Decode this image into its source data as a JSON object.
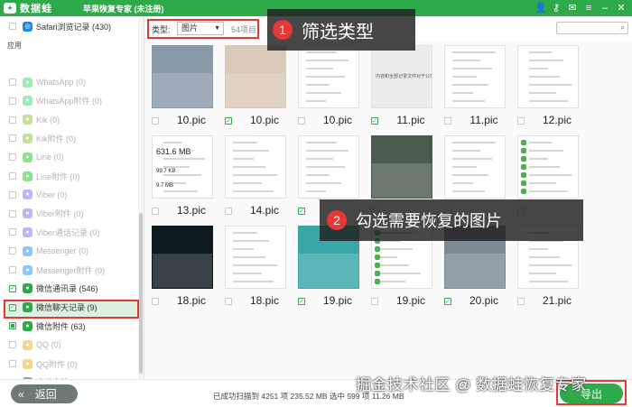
{
  "app": {
    "logo_text": "数据蛙",
    "title": "苹果恢复专家 (未注册)"
  },
  "title_icons": [
    "person-icon",
    "key-icon",
    "chat-icon",
    "menu-icon",
    "minimize-icon",
    "close-icon"
  ],
  "sidebar": {
    "top_item": "Safari浏览记录 (430)",
    "section": "应用",
    "items": [
      {
        "label": "WhatsApp (0)",
        "icon": "whatsapp-icon",
        "color": "#25d366",
        "checked": false,
        "dim": true
      },
      {
        "label": "WhatsApp附件 (0)",
        "icon": "whatsapp-icon",
        "color": "#25d366",
        "checked": false,
        "dim": true
      },
      {
        "label": "Kik (0)",
        "icon": "kik-icon",
        "color": "#82bc23",
        "checked": false,
        "dim": true
      },
      {
        "label": "Kik附件 (0)",
        "icon": "kik-icon",
        "color": "#82bc23",
        "checked": false,
        "dim": true
      },
      {
        "label": "Line (0)",
        "icon": "line-icon",
        "color": "#00c300",
        "checked": false,
        "dim": true
      },
      {
        "label": "Line附件 (0)",
        "icon": "line-icon",
        "color": "#00c300",
        "checked": false,
        "dim": true
      },
      {
        "label": "Viber (0)",
        "icon": "viber-icon",
        "color": "#7360f2",
        "checked": false,
        "dim": true
      },
      {
        "label": "Viber附件 (0)",
        "icon": "viber-icon",
        "color": "#7360f2",
        "checked": false,
        "dim": true
      },
      {
        "label": "Viber通话记录 (0)",
        "icon": "viber-icon",
        "color": "#7360f2",
        "checked": false,
        "dim": true
      },
      {
        "label": "Messenger (0)",
        "icon": "messenger-icon",
        "color": "#0084ff",
        "checked": false,
        "dim": true
      },
      {
        "label": "Messenger附件 (0)",
        "icon": "messenger-icon",
        "color": "#0084ff",
        "checked": false,
        "dim": true
      },
      {
        "label": "微信通讯录 (546)",
        "icon": "wechat-icon",
        "color": "#2eaa4b",
        "checked": true,
        "dim": false
      },
      {
        "label": "微信聊天记录 (9)",
        "icon": "wechat-icon",
        "color": "#2eaa4b",
        "checked": true,
        "dim": false
      },
      {
        "label": "微信附件 (63)",
        "icon": "wechat-icon",
        "color": "#2eaa4b",
        "checked": "partial",
        "dim": false
      },
      {
        "label": "QQ (0)",
        "icon": "qq-icon",
        "color": "#e5a300",
        "checked": false,
        "dim": true
      },
      {
        "label": "QQ附件 (0)",
        "icon": "qq-icon",
        "color": "#e5a300",
        "checked": false,
        "dim": true
      },
      {
        "label": "应用文档 (49)",
        "icon": "document-icon",
        "color": "#9aa0a6",
        "checked": false,
        "dim": false
      }
    ]
  },
  "toolbar": {
    "type_label": "类型:",
    "type_value": "图片",
    "count": "54项目"
  },
  "grid": {
    "rows": [
      [
        {
          "name": "10.pic",
          "checked": false
        },
        {
          "name": "10.pic",
          "checked": true
        },
        {
          "name": "10.pic",
          "checked": false
        },
        {
          "name": "11.pic",
          "checked": true
        },
        {
          "name": "11.pic",
          "checked": false
        },
        {
          "name": "12.pic",
          "checked": false
        }
      ],
      [
        {
          "name": "13.pic",
          "checked": false
        },
        {
          "name": "14.pic",
          "checked": false
        },
        {
          "name": "",
          "checked": true
        },
        {
          "name": "",
          "checked": false
        },
        {
          "name": "",
          "checked": false
        },
        {
          "name": "",
          "checked": false
        }
      ],
      [
        {
          "name": "18.pic",
          "checked": false
        },
        {
          "name": "18.pic",
          "checked": false
        },
        {
          "name": "19.pic",
          "checked": true
        },
        {
          "name": "19.pic",
          "checked": false
        },
        {
          "name": "20.pic",
          "checked": true
        },
        {
          "name": "21.pic",
          "checked": false
        }
      ]
    ],
    "thumb_text": {
      "storage_size": "631.6 MB",
      "small_size_a": "99.7 KB",
      "small_size_b": "9.7 MB",
      "blank_caption": "内容和全部记录文件对于公司"
    }
  },
  "callouts": [
    {
      "number": "1",
      "text": "筛选类型"
    },
    {
      "number": "2",
      "text": "勾选需要恢复的图片"
    }
  ],
  "bottom": {
    "back_label": "返回",
    "status": "已成功扫描到 4251 项 235.52 MB   选中 599 项 11.26 MB",
    "export_label": "导出"
  },
  "watermark": "掘金技术社区 @ 数据蛙恢复专家",
  "colors": {
    "brand": "#2eaa4b",
    "highlight_red": "#e53935"
  }
}
